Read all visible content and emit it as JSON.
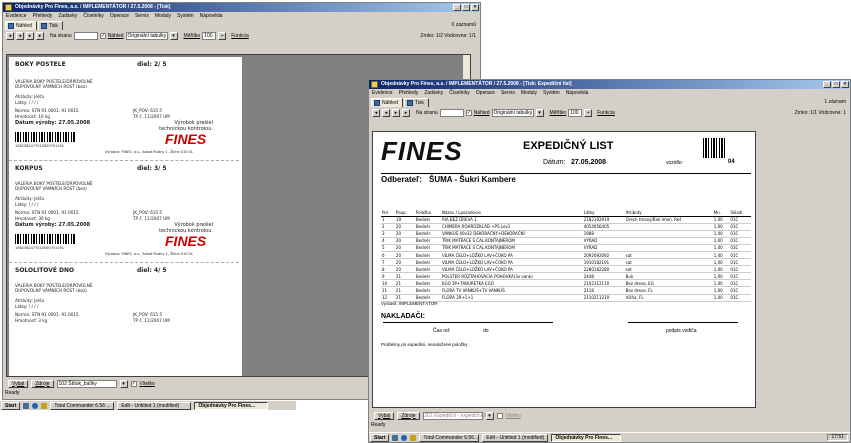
{
  "window1": {
    "title": "Objednávky Pro Fines, a.s. / IMPLEMENTÁTOR / 27.5.2008 - [Tisk]",
    "menu": [
      "Evidence",
      "Přehledy",
      "Zadávky",
      "Číselníky",
      "Operace",
      "Servis",
      "Moduly",
      "Systém",
      "Nápověda"
    ],
    "tabs": [
      "Náhled",
      "Tisk"
    ],
    "right_status": "0 záznamů",
    "toolbar": {
      "page_label": "Na stranu",
      "page_value": "",
      "check_label": "Náhled",
      "select_value": "Originální tabulky",
      "zoom_label": "Měřítko",
      "zoom_value": "100",
      "function_label": "Funkcia",
      "page_info": "Zrnko: 1/2 Vodcovne: 1/1"
    },
    "labels": [
      {
        "name": "BOKY POSTELE",
        "dil": "diel: 2/ 5",
        "line1": "VALERIA BOKY POSTELE/DRPOVOLNÉ",
        "line2": "DUPOVOLNÝ VÁMNÍCH ROST (bez)",
        "attr1": "Atribúty: Jelša",
        "attr2": "Látky: / / / /",
        "norm": "Norma: STN 91 0001, 91 0015",
        "weight": "Hmotnosť: 10 kg",
        "code": "JK_POV: 615 5",
        "tp": "TP č. 11/2007 UM",
        "date": "Dátum výroby: 27.05.2008",
        "control": "Výrobok prešiel technickou kontrolou.",
        "ean": "1062362477010500751191",
        "producer": "Výrobca: FINES, a.s., Sobot Rudny 1, Žilina 010 01"
      },
      {
        "name": "KORPUS",
        "dil": "diel: 3/ 5",
        "line1": "VALERIA BOKY POSTELE/DRPOVOLNÉ",
        "line2": "DUPOVOLNÝ VÁMNÍCH ROST (bez)",
        "attr1": "Atribúty: Jelša",
        "attr2": "Látky: / / / /",
        "norm": "Norma: STN 91 0001, 91 0015",
        "weight": "Hmotnosť: 30 kg",
        "code": "JK_POV: 615 5",
        "tp": "TP č. 11/2007 UM",
        "date": "Dátum výroby: 27.05.2008",
        "control": "Výrobok prešiel technickou kontrolou.",
        "ean": "1062362477010500751191",
        "producer": "Výrobca: FINES, a.s., Sobot Rudny 1, Žilina 010 01"
      },
      {
        "name": "SOLOLITOVÉ DNO",
        "dil": "diel: 4/ 5",
        "line1": "VALERIA BOKY POSTELE/DRPOVOLNÉ",
        "line2": "DUPOVOLNÝ VÁMNÍCH ROST (bez)",
        "attr1": "Atribúty: Jelša",
        "attr2": "Látky: / / / /",
        "norm": "Norma: STN 91 0001, 91 0015",
        "weight": "Hmotnosť: 3 kg",
        "code": "JK_POV: 615 5",
        "tp": "TP č. 11/2007 UM",
        "date": "",
        "control": "",
        "ean": "",
        "producer": ""
      }
    ],
    "brand": "FINES",
    "bottom": {
      "close_label": "Vybal",
      "print_label": "Zdroje",
      "report_value": "102 Štítok_balíky",
      "check_label": "Všetko"
    }
  },
  "window2": {
    "title": "Objednávky Pro Fines, a.s. / IMPLEMENTÁTOR / 27.5.2008 - [Tisk: Expediční list]",
    "menu": [
      "Evidence",
      "Přehledy",
      "Zadávky",
      "Číselníky",
      "Operace",
      "Servis",
      "Moduly",
      "Systém",
      "Nápověda"
    ],
    "tabs": [
      "Náhled",
      "Tisk"
    ],
    "right_status": "1 záznam",
    "toolbar": {
      "page_label": "Na stranu",
      "check_label": "Náhled",
      "select_value": "Originální tabulky",
      "zoom_label": "Měřítko",
      "zoom_value": "100",
      "function_label": "Funkcia",
      "page_info": "Zrnko: 1/1 Vodcovne: 1"
    },
    "doc": {
      "brand": "FINES",
      "title": "EXPEDIČNÝ LIST",
      "date_label": "Dátum:",
      "date_value": "27.05.2008",
      "vozidlo_label": "vozidlo:",
      "vozidlo_value": "04",
      "receiver_label": "Odberateľ:",
      "receiver_value": "ŠUMA - Šukri Kambere",
      "columns": [
        "Pol.",
        "Poup.",
        "Položka",
        "Názov / Lpozadovie",
        "Látky",
        "Atribúty",
        "Mn.",
        "Skladi"
      ],
      "rows": [
        [
          "1",
          "19",
          "Bedněr",
          "RIA BEZ DREVA 1",
          "2182192919",
          "Orech tmavý/Biel Imen. Reš",
          "1,00",
          "01C"
        ],
        [
          "2",
          "20",
          "Bedněr",
          "CHIMERA ROHROZKLAD +PS Lev1",
          "4054056405",
          "",
          "1,00",
          "01C"
        ],
        [
          "3",
          "20",
          "Bedněr",
          "VANKÚŠ 40x32 DEKORAČNÝ+DEKORAČNÍ",
          "1988",
          "",
          "1,00",
          "01C"
        ],
        [
          "4",
          "20",
          "Bedněr",
          "TRIK MATRACE S ČAL.KONTAJNEROM",
          "VYRAD",
          "",
          "1,00",
          "01C"
        ],
        [
          "5",
          "20",
          "Bedněr",
          "TRIK MATRACE S ČAL.KONTAJNEROM",
          "VYRAD",
          "",
          "1,00",
          "01C"
        ],
        [
          "6",
          "20",
          "Bedněr",
          "VILMA ČELO+LOŽKO LAV+ČOKO PA",
          "2092092092",
          "sat",
          "1,00",
          "01C"
        ],
        [
          "7",
          "20",
          "Bedněr",
          "VILMA ČELO+LOŽKO LAV+ČOKO PA",
          "1910182191",
          "sat",
          "1,00",
          "01C"
        ],
        [
          "8",
          "20",
          "Bedněr",
          "VILMA ČELO+LOŽKO LAV+ČOKO PA",
          "2280182280",
          "sat",
          "1,00",
          "01C"
        ],
        [
          "9",
          "21",
          "Bedněr",
          "POLSTER ROZTAHOVACIA POHOVKA(3x vank)",
          "2448",
          "Buk",
          "1,00",
          "01C"
        ],
        [
          "10",
          "21",
          "Bedněr",
          "EGO 3P+TABURETKA EGO",
          "2102112110",
          "Bez dreva, EG",
          "1,00",
          "01C"
        ],
        [
          "11",
          "21",
          "Bedněr",
          "FLORA TV VANKÚŠ+TV VANKÚŠ",
          "2118",
          "Bez dreva, FL",
          "1,00",
          "01C"
        ],
        [
          "12",
          "21",
          "Bedněr",
          "FLORA 3R+1+1",
          "2110211210",
          "Višňa, FL",
          "1,00",
          "01C"
        ]
      ],
      "issued_by": "Vystavil: IMPLEMENTÁTOR",
      "loading_label": "NAKLADAČI:",
      "time_label": "Čas od:",
      "time_to": "do",
      "driver_sig": "podpis vodiča",
      "problems": "Problémy pri expedícii, nenaložené položky"
    },
    "bottom": {
      "close_label": "Vybal",
      "print_label": "Zdroje",
      "report_value": "201 Expediční - expediční list",
      "check_label": "Všetko"
    },
    "tray_time": "17:51"
  },
  "status": {
    "ready": "Ready"
  },
  "taskbar": {
    "start": "Start",
    "tasks": [
      "Total Commander 6.56 ...",
      "Edit - Untitled 1 (modified)",
      "Objednávky Pro Fines..."
    ]
  },
  "colors": {
    "titlebar": "#0a246a",
    "brand": "#cc0000",
    "window": "#d4d0c8"
  }
}
